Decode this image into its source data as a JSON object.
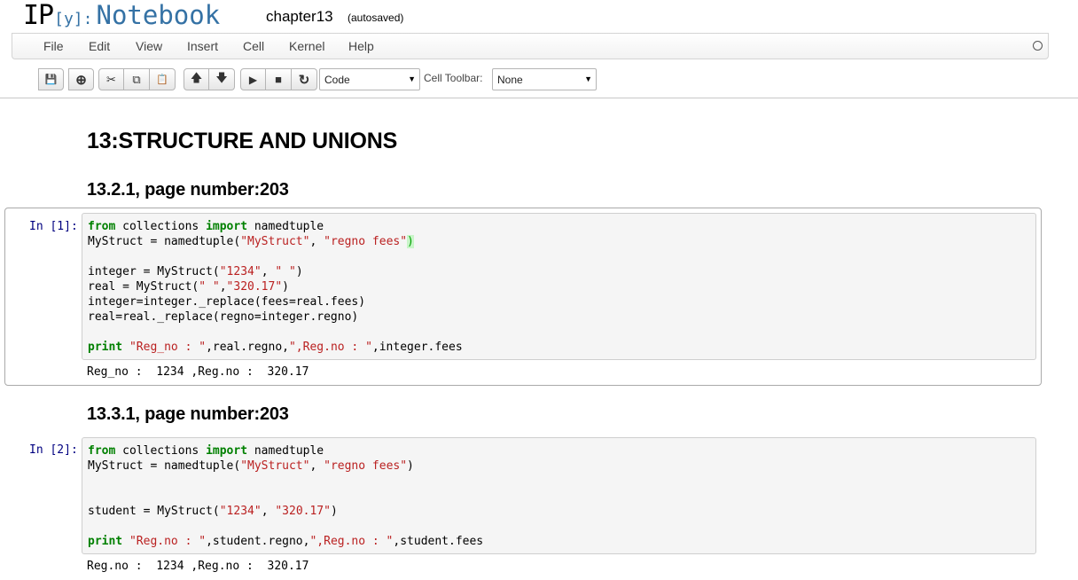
{
  "header": {
    "logo_ip": "IP",
    "logo_y": "[y]:",
    "logo_notebook": "Notebook",
    "notebook_name": "chapter13",
    "autosave_status": "(autosaved)"
  },
  "menu": {
    "items": [
      "File",
      "Edit",
      "View",
      "Insert",
      "Cell",
      "Kernel",
      "Help"
    ]
  },
  "toolbar": {
    "icons": {
      "save": "💾",
      "insert": "⊕",
      "cut": "✂",
      "copy": "⧉",
      "paste": "📋",
      "up": "🡅",
      "down": "🡇",
      "run": "▶",
      "stop": "■",
      "restart": "↻"
    },
    "cell_type": "Code",
    "cell_toolbar_label": "Cell Toolbar:",
    "cell_toolbar_value": "None",
    "dropdown_arrow": "▼"
  },
  "content": {
    "heading1": "13:STRUCTURE AND UNIONS",
    "heading2a": "13.2.1, page number:203",
    "heading2b": "13.3.1, page number:203",
    "cell1": {
      "prompt": "In [1]:",
      "output": "Reg_no :  1234 ,Reg.no :  320.17"
    },
    "cell2": {
      "prompt": "In [2]:",
      "output": "Reg.no :  1234 ,Reg.no :  320.17"
    },
    "code_tokens": {
      "from": "from",
      "import": "import",
      "print": "print",
      "c1_l1": " collections ",
      "c1_l1b": " namedtuple",
      "c1_l2a": "MyStruct = namedtuple(",
      "c1_l2s1": "\"MyStruct\"",
      "c1_l2sep": ", ",
      "c1_l2s2": "\"regno fees\"",
      "c1_l2end": ")",
      "c1_l4a": "integer = MyStruct(",
      "c1_l4s1": "\"1234\"",
      "c1_l4sep": ", ",
      "c1_l4s2": "\" \"",
      "c1_l4end": ")",
      "c1_l5a": "real = MyStruct(",
      "c1_l5s1": "\" \"",
      "c1_l5sep": ",",
      "c1_l5s2": "\"320.17\"",
      "c1_l5end": ")",
      "c1_l6": "integer=integer._replace(fees=real.fees)",
      "c1_l7": "real=real._replace(regno=integer.regno)",
      "c1_l9s1": " \"Reg_no : \"",
      "c1_l9m": ",real.regno,",
      "c1_l9s2": "\",Reg.no : \"",
      "c1_l9end": ",integer.fees",
      "c2_l1": " collections ",
      "c2_l1b": " namedtuple",
      "c2_l2a": "MyStruct = namedtuple(",
      "c2_l2s1": "\"MyStruct\"",
      "c2_l2sep": ", ",
      "c2_l2s2": "\"regno fees\"",
      "c2_l2end": ")",
      "c2_l5a": "student = MyStruct(",
      "c2_l5s1": "\"1234\"",
      "c2_l5sep": ", ",
      "c2_l5s2": "\"320.17\"",
      "c2_l5end": ")",
      "c2_l7s1": " \"Reg.no : \"",
      "c2_l7m": ",student.regno,",
      "c2_l7s2": "\",Reg.no : \"",
      "c2_l7end": ",student.fees"
    }
  }
}
